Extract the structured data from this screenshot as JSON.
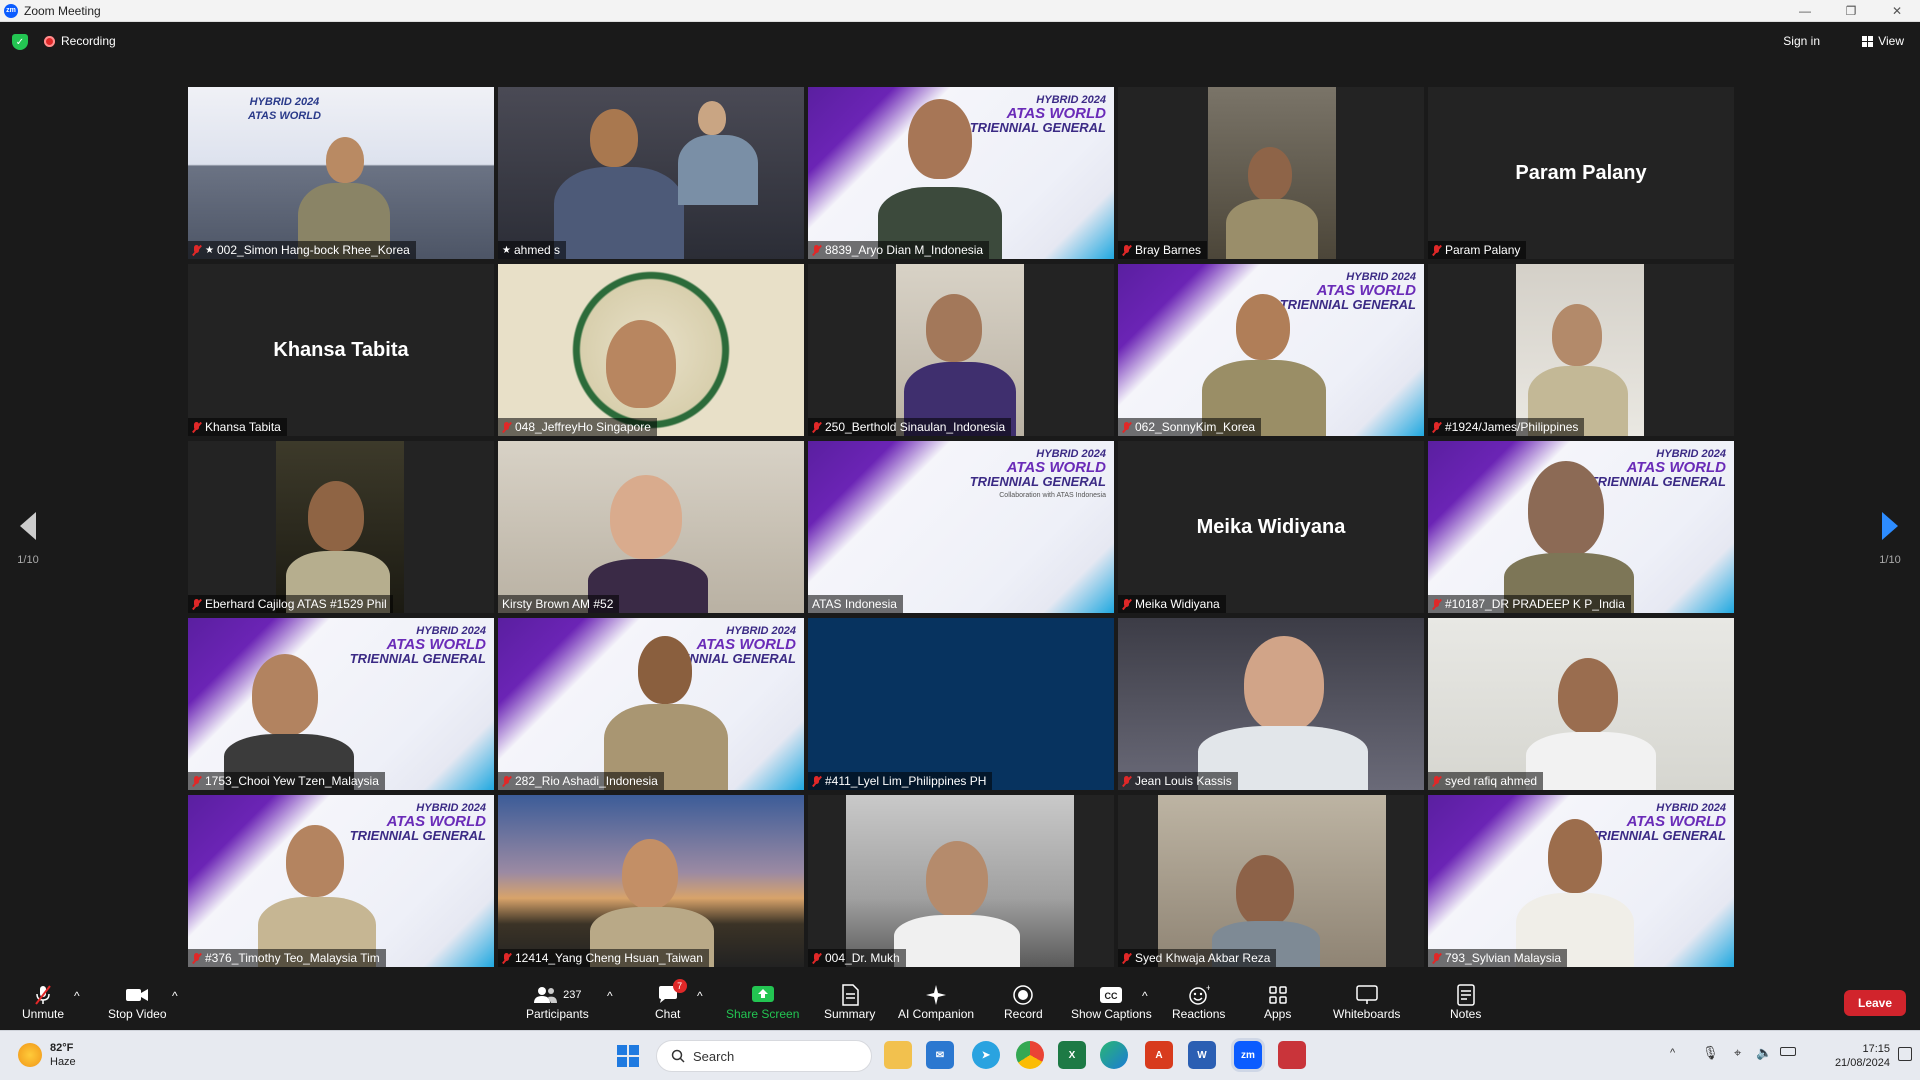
{
  "window": {
    "title": "Zoom Meeting"
  },
  "topbar": {
    "recording_label": "Recording",
    "signin_label": "Sign in",
    "view_label": "View"
  },
  "pager": {
    "left": "1/10",
    "right": "1/10"
  },
  "tiles": [
    {
      "name": "002_Simon Hang-bock Rhee_Korea",
      "muted": true,
      "pinned": true
    },
    {
      "name": "ahmed s",
      "muted": false,
      "pinned": true,
      "active": true
    },
    {
      "name": "8839_Aryo Dian M_Indonesia",
      "muted": true
    },
    {
      "name": "Bray Barnes",
      "muted": true
    },
    {
      "name": "Param Palany",
      "muted": true,
      "center_name": "Param Palany"
    },
    {
      "name": "Khansa Tabita",
      "muted": true,
      "center_name": "Khansa Tabita"
    },
    {
      "name": "048_JeffreyHo Singapore",
      "muted": true
    },
    {
      "name": "250_Berthold Sinaulan_Indonesia",
      "muted": true
    },
    {
      "name": "062_SonnyKim_Korea",
      "muted": true
    },
    {
      "name": "#1924/James/Philippines",
      "muted": true
    },
    {
      "name": "Eberhard Cajilog ATAS #1529 Phil",
      "muted": true
    },
    {
      "name": "Kirsty Brown AM #52",
      "muted": false
    },
    {
      "name": "ATAS Indonesia",
      "muted": false
    },
    {
      "name": "Meika Widiyana",
      "muted": true,
      "center_name": "Meika Widiyana"
    },
    {
      "name": "#10187_DR PRADEEP K P_India",
      "muted": true
    },
    {
      "name": "1753_Chooi Yew Tzen_Malaysia",
      "muted": true
    },
    {
      "name": "282_Rio Ashadi_Indonesia",
      "muted": true
    },
    {
      "name": "#411_Lyel Lim_Philippines PH",
      "muted": true
    },
    {
      "name": "Jean Louis Kassis",
      "muted": true
    },
    {
      "name": "syed rafiq ahmed",
      "muted": true
    },
    {
      "name": "#376_Timothy Teo_Malaysia Tim",
      "muted": true
    },
    {
      "name": "12414_Yang Cheng Hsuan_Taiwan",
      "muted": true
    },
    {
      "name": "004_Dr. Mukh",
      "muted": true
    },
    {
      "name": "Syed Khwaja Akbar Reza",
      "muted": true
    },
    {
      "name": "793_Sylvian Malaysia",
      "muted": true
    }
  ],
  "banner": {
    "l1": "HYBRID 2024",
    "l2": "ATAS WORLD",
    "l3": "TRIENNIAL GENERAL",
    "l4": "Collaboration with ATAS Indonesia"
  },
  "toolbar": {
    "unmute": "Unmute",
    "stop_video": "Stop Video",
    "participants": "Participants",
    "participants_count": "237",
    "chat": "Chat",
    "chat_badge": "7",
    "share_screen": "Share Screen",
    "summary": "Summary",
    "ai_companion": "AI Companion",
    "record": "Record",
    "show_captions": "Show Captions",
    "reactions": "Reactions",
    "apps": "Apps",
    "whiteboards": "Whiteboards",
    "notes": "Notes",
    "leave": "Leave"
  },
  "taskbar": {
    "temp": "82°F",
    "weather": "Haze",
    "search": "Search",
    "time": "17:15",
    "date": "21/08/2024"
  },
  "colors": {
    "zoom_blue": "#0b5cff",
    "leave_red": "#d1242c",
    "share_green": "#23c552",
    "active_speaker": "#c6ef3a"
  }
}
